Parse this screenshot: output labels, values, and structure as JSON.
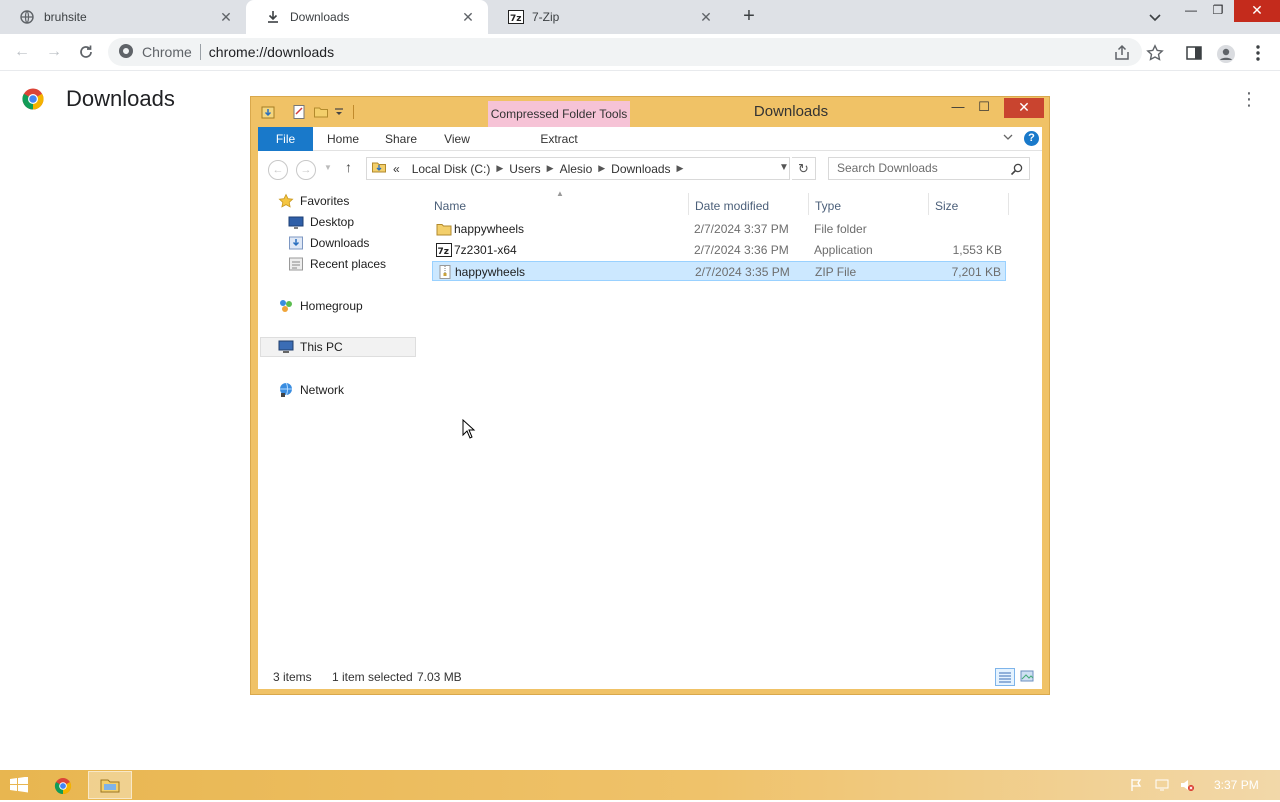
{
  "browser": {
    "tabs": [
      {
        "title": "bruhsite",
        "icon": "globe-icon",
        "active": false
      },
      {
        "title": "Downloads",
        "icon": "download-icon",
        "active": true
      },
      {
        "title": "7-Zip",
        "icon": "7zip-icon",
        "active": false
      }
    ],
    "omnibox": {
      "chip": "Chrome",
      "url": "chrome://downloads"
    }
  },
  "downloads_page": {
    "title": "Downloads"
  },
  "explorer": {
    "window_title": "Downloads",
    "context_tab": "Compressed Folder Tools",
    "ribbon_tabs": [
      "File",
      "Home",
      "Share",
      "View",
      "Extract"
    ],
    "address": {
      "prefix": "«",
      "segments": [
        "Local Disk (C:)",
        "Users",
        "Alesio",
        "Downloads"
      ]
    },
    "search_placeholder": "Search Downloads",
    "nav": {
      "favorites": "Favorites",
      "desktop": "Desktop",
      "downloads": "Downloads",
      "recent": "Recent places",
      "homegroup": "Homegroup",
      "this_pc": "This PC",
      "network": "Network"
    },
    "columns": {
      "name": "Name",
      "date": "Date modified",
      "type": "Type",
      "size": "Size"
    },
    "files": [
      {
        "name": "happywheels",
        "date": "2/7/2024 3:37 PM",
        "type": "File folder",
        "size": "",
        "icon": "folder-icon",
        "selected": false
      },
      {
        "name": "7z2301-x64",
        "date": "2/7/2024 3:36 PM",
        "type": "Application",
        "size": "1,553 KB",
        "icon": "7zip-app-icon",
        "selected": false
      },
      {
        "name": "happywheels",
        "date": "2/7/2024 3:35 PM",
        "type": "ZIP File",
        "size": "7,201 KB",
        "icon": "zip-file-icon",
        "selected": true
      }
    ],
    "status": {
      "count": "3 items",
      "selection": "1 item selected",
      "size": "7.03 MB"
    }
  },
  "taskbar": {
    "clock": "3:37 PM"
  }
}
